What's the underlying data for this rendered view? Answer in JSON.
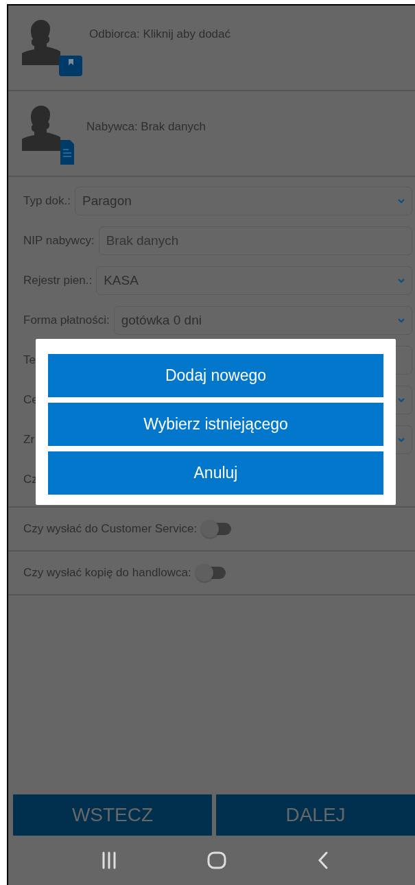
{
  "contacts": [
    {
      "kind": "recipient",
      "text": "Odbiorca: Kliknij aby dodać"
    },
    {
      "kind": "buyer",
      "text": "Nabywca: Brak danych"
    }
  ],
  "form": [
    {
      "kind": "select",
      "label": "Typ dok.:",
      "value": "Paragon"
    },
    {
      "kind": "input",
      "label": "NIP nabywcy:",
      "placeholder": "Brak danych"
    },
    {
      "kind": "select",
      "label": "Rejestr pien.:",
      "value": "KASA"
    },
    {
      "kind": "select",
      "label": "Forma płatności:",
      "value": "gotówka 0 dni"
    },
    {
      "kind": "input",
      "label": "Te"
    },
    {
      "kind": "select",
      "label": "Ce"
    },
    {
      "kind": "select",
      "label": "Zr"
    },
    {
      "kind": "label",
      "label": "Cz"
    }
  ],
  "switches": [
    {
      "label": "Czy wysłać do Customer Service:",
      "on": false
    },
    {
      "label": "Czy wysłać kopię do handlowca:",
      "on": false
    }
  ],
  "dialog": {
    "buttons": [
      "Dodaj nowego",
      "Wybierz istniejącego",
      "Anuluj"
    ]
  },
  "footer": {
    "buttons": [
      "WSTECZ",
      "DALEJ"
    ]
  }
}
